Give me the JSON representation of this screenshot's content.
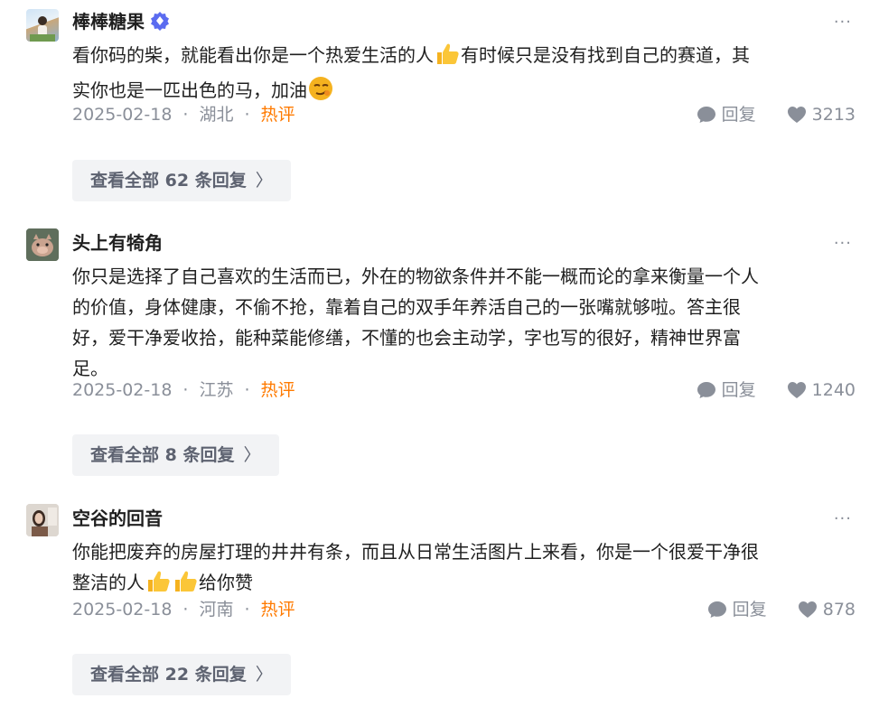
{
  "comments": [
    {
      "name": "棒棒糖果",
      "verified": true,
      "lines": [
        [
          "看你码的柴，就能看出你是一个热爱生活的人",
          "thumbs-up",
          "有时候只是没有找到自己的赛道，其"
        ],
        [
          "实你也是一匹出色的马，加油",
          "smirk"
        ]
      ],
      "date": "2025-02-18",
      "location": "湖北",
      "tag": "热评",
      "reply_label": "回复",
      "likes": "3213",
      "view_prefix": "查看全部",
      "view_count": "62",
      "view_suffix": "条回复",
      "more": "···"
    },
    {
      "name": "头上有犄角",
      "verified": false,
      "lines": [
        [
          "你只是选择了自己喜欢的生活而已，外在的物欲条件并不能一概而论的拿来衡量一个人"
        ],
        [
          "的价值，身体健康，不偷不抢，靠着自己的双手年养活自己的一张嘴就够啦。答主很"
        ],
        [
          "好，爱干净爱收拾，能种菜能修缮，不懂的也会主动学，字也写的很好，精神世界富"
        ],
        [
          "足。"
        ]
      ],
      "date": "2025-02-18",
      "location": "江苏",
      "tag": "热评",
      "reply_label": "回复",
      "likes": "1240",
      "view_prefix": "查看全部",
      "view_count": "8",
      "view_suffix": "条回复",
      "more": "···"
    },
    {
      "name": "空谷的回音",
      "verified": false,
      "lines": [
        [
          "你能把废弃的房屋打理的井井有条，而且从日常生活图片上来看，你是一个很爱干净很"
        ],
        [
          "整洁的人",
          "thumbs-up",
          "thumbs-up",
          "给你赞"
        ]
      ],
      "date": "2025-02-18",
      "location": "河南",
      "tag": "热评",
      "reply_label": "回复",
      "likes": "878",
      "view_prefix": "查看全部",
      "view_count": "22",
      "view_suffix": "条回复",
      "more": "···"
    }
  ],
  "colors": {
    "hot_tag": "#ff7a00",
    "meta": "#8a8f99",
    "button_bg": "#f2f3f5",
    "verified": "#5b6cf0"
  }
}
